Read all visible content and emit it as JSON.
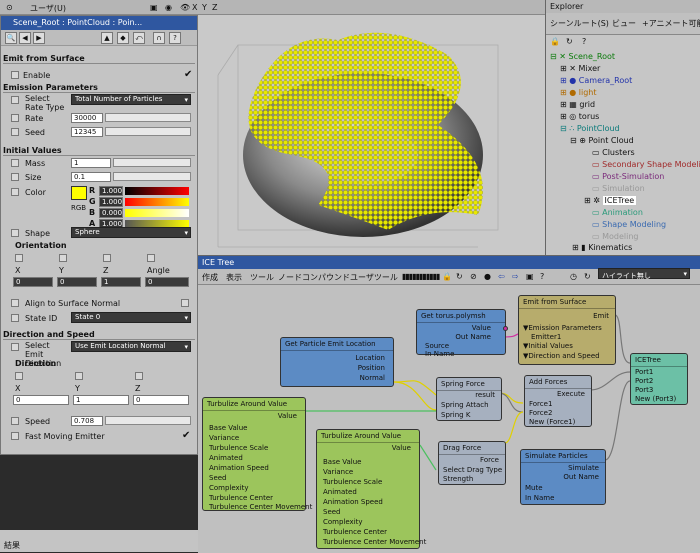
{
  "viewport": {
    "user_label": "ユーザ(U)",
    "axes": [
      "X",
      "Y",
      "Z"
    ]
  },
  "ppg": {
    "title": "Scene_Root : PointCloud : Poin...",
    "section_main": "Emit from Surface",
    "enable": "Enable",
    "emission": "Emission Parameters",
    "select_rate_type": "Select Rate Type",
    "rate_type_value": "Total Number of Particles",
    "rate": "Rate",
    "rate_value": "30000",
    "seed": "Seed",
    "seed_value": "12345",
    "initial_values": "Initial Values",
    "mass": "Mass",
    "mass_value": "1",
    "size": "Size",
    "size_value": "0.1",
    "color": "Color",
    "rgba_labels": [
      "R",
      "G",
      "B",
      "A"
    ],
    "rgba_values": [
      "1.000",
      "1.000",
      "0.000",
      "1.000"
    ],
    "rgb": "RGB",
    "shape": "Shape",
    "shape_value": "Sphere",
    "orientation": "Orientation",
    "xyz_angle": [
      "X",
      "Y",
      "Z",
      "Angle"
    ],
    "orientation_values": [
      "0",
      "0",
      "1",
      "0"
    ],
    "align": "Align to Surface Normal",
    "state_id": "State ID",
    "state_value": "State 0",
    "direction_speed": "Direction and Speed",
    "select_emit_dir": "Select Emit Direction",
    "emit_dir_value": "Use Emit Location Normal",
    "direction": "Direction",
    "dir_labels": [
      "X",
      "Y",
      "Z"
    ],
    "dir_values": [
      "0",
      "1",
      "0"
    ],
    "speed": "Speed",
    "speed_value": "0.708",
    "fast_moving": "Fast Moving Emitter",
    "status": "結果"
  },
  "explorer": {
    "title": "Explorer",
    "menu": [
      "シーンルート(S)",
      "ビュー",
      "+アニメート可能な"
    ],
    "items": [
      {
        "label": "Scene_Root",
        "color": "#0a7a0a"
      },
      {
        "label": "Mixer",
        "color": "#111"
      },
      {
        "label": "Camera_Root",
        "color": "#2233aa"
      },
      {
        "label": "light",
        "color": "#b06a00"
      },
      {
        "label": "grid",
        "color": "#111"
      },
      {
        "label": "torus",
        "color": "#111"
      },
      {
        "label": "PointCloud",
        "color": "#0a7a7a"
      },
      {
        "label": "Point Cloud",
        "color": "#111"
      },
      {
        "label": "Clusters",
        "color": "#111"
      },
      {
        "label": "Secondary Shape Modeling",
        "color": "#a02a2a"
      },
      {
        "label": "Post-Simulation",
        "color": "#7a2a7a"
      },
      {
        "label": "Simulation",
        "color": "#999"
      },
      {
        "label": "ICETree",
        "color": "#111"
      },
      {
        "label": "Animation",
        "color": "#2a9a7a"
      },
      {
        "label": "Shape Modeling",
        "color": "#3a6ab0"
      },
      {
        "label": "Modeling",
        "color": "#999"
      },
      {
        "label": "Kinematics",
        "color": "#111"
      }
    ]
  },
  "ice": {
    "title": "ICE Tree",
    "menu": [
      "作成",
      "表示",
      "ツール",
      "ノード",
      "コンパウンド",
      "ユーザツール"
    ],
    "highlight": "ハイライト無し",
    "nodes": {
      "get_torus": {
        "title": "Get torus.polymsh",
        "ports": [
          "Value",
          "Out Name",
          "Source",
          "In Name"
        ]
      },
      "emit": {
        "title": "Emit from Surface",
        "ports": [
          "Emit",
          "▼Emission Parameters",
          "Emitter1",
          "▼Initial Values",
          "▼Direction and Speed"
        ]
      },
      "get_loc": {
        "title": "Get Particle Emit Location",
        "ports": [
          "Location",
          "Position",
          "Normal"
        ]
      },
      "spring": {
        "title": "Spring Force",
        "ports": [
          "result",
          "Spring Attach",
          "Spring K"
        ]
      },
      "add": {
        "title": "Add Forces",
        "ports": [
          "Execute",
          "Force1",
          "Force2",
          "New (Force1)"
        ]
      },
      "icetree": {
        "title": "ICETree",
        "ports": [
          "Port1",
          "Port2",
          "Port3",
          "New (Port3)"
        ]
      },
      "turb1": {
        "title": "Turbulize Around Value",
        "ports": [
          "Value",
          "Base Value",
          "Variance",
          "Turbulence Scale",
          "Animated",
          "Animation Speed",
          "Seed",
          "Complexity",
          "Turbulence Center",
          "Turbulence Center Movement"
        ]
      },
      "turb2": {
        "title": "Turbulize Around Value",
        "ports": [
          "Value",
          "Base Value",
          "Variance",
          "Turbulence Scale",
          "Animated",
          "Animation Speed",
          "Seed",
          "Complexity",
          "Turbulence Center",
          "Turbulence Center Movement"
        ]
      },
      "drag": {
        "title": "Drag Force",
        "ports": [
          "Force",
          "Select Drag Type",
          "Strength"
        ]
      },
      "simulate": {
        "title": "Simulate Particles",
        "ports": [
          "Simulate",
          "Out Name",
          "Mute",
          "In Name"
        ]
      }
    }
  }
}
